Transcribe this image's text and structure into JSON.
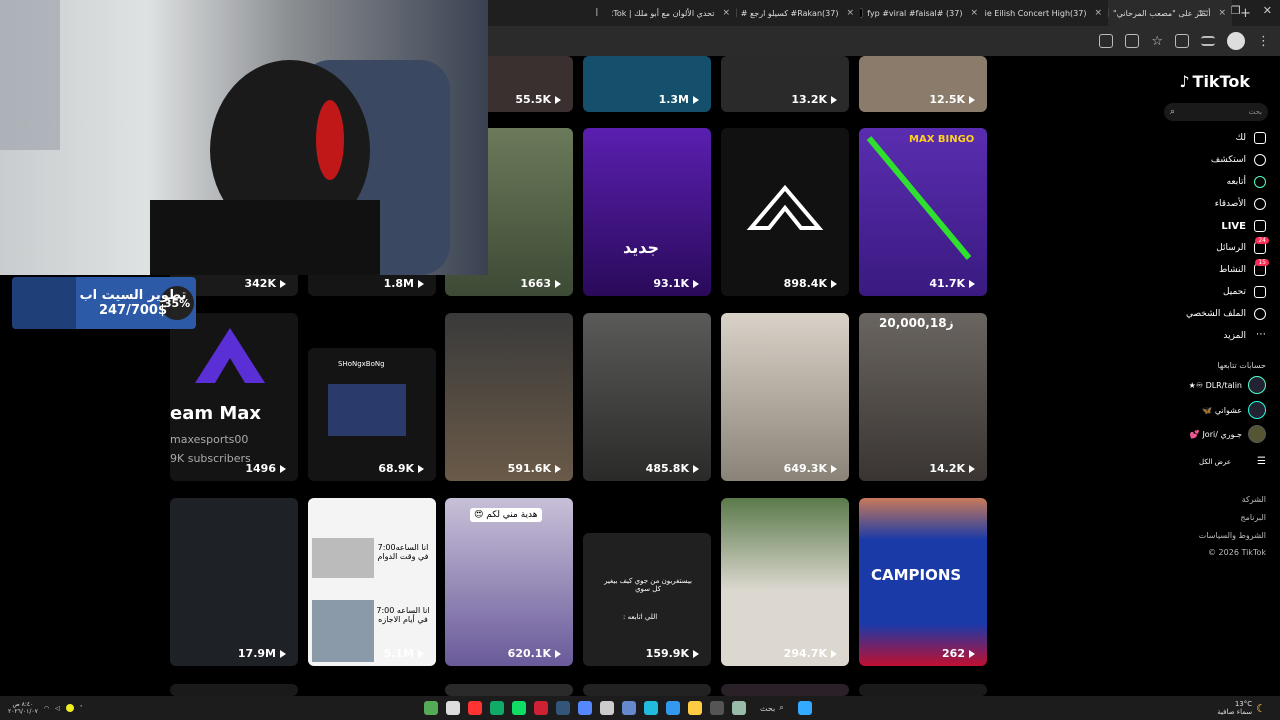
{
  "browser": {
    "tabs": [
      {
        "label": "أنظر على \"مصعب المرحاني\"",
        "close": "×"
      },
      {
        "label": "(37)Billie Eilish Concert High",
        "close": "×"
      },
      {
        "label": "(37) #fyp #viral #faisal",
        "close": "×"
      },
      {
        "label": "(37)Rakan# كسيلو ارجع #",
        "close": "×"
      },
      {
        "label": "تحدي الألوان مع أبو ملك | TikTok",
        "close": "×"
      },
      {
        "label": "أ",
        "close": ""
      }
    ],
    "new_tab": "+"
  },
  "sidebar": {
    "logo": "TikTok",
    "search_placeholder": "بحث",
    "nav": [
      {
        "label": "لك"
      },
      {
        "label": "استكشف"
      },
      {
        "label": "أتابعه"
      },
      {
        "label": "الأصدقاء"
      },
      {
        "label": "LIVE"
      },
      {
        "label": "الرسائل",
        "badge": "24"
      },
      {
        "label": "النشاط",
        "badge": "15"
      },
      {
        "label": "تحميل"
      },
      {
        "label": "الملف الشخصي"
      },
      {
        "label": "المزيد"
      }
    ],
    "following_title": "حسابات تتابعها",
    "accounts": [
      {
        "name": "DLR/talin ♾★"
      },
      {
        "name": "عشواني 🦋"
      },
      {
        "name": "جـوري /Jori 💕"
      }
    ],
    "show_all": "عرض الكل",
    "footer": [
      "الشركة",
      "البرنامج",
      "الشروط والسياسات",
      "© 2026 TikTok"
    ]
  },
  "grid": {
    "row0": [
      "55.5K",
      "1.3M",
      "13.2K",
      "12.5K"
    ],
    "row1": [
      "342K",
      "1.8M",
      "1663",
      "93.1K",
      "898.4K",
      "41.7K"
    ],
    "row2": [
      "1496",
      "68.9K",
      "591.6K",
      "485.8K",
      "649.3K",
      "14.2K"
    ],
    "row3": [
      "17.9M",
      "5.1M",
      "620.1K",
      "159.9K",
      "294.7K",
      "262"
    ],
    "overlays": {
      "team_max": "eam Max",
      "maxesports": "maxesports00",
      "subscribers": "9K subscribers",
      "shongx": "SHoNgxBoNg",
      "jadeed": "جديد",
      "max_bingo": "MAX BINGO",
      "count_2m": "20,000,18ز",
      "campions": "CAMPIONS",
      "gift": "هدية مني لكم 😍",
      "time_work": "انا الساعه7:00 في وقت الدوام",
      "time_off": "انا الساعه 7:00 في أيام الاجازه",
      "seriously": "بيستغربون من جوي كيف بيغير كل سوي",
      "followers_label": "اللي اتابعه :"
    }
  },
  "webcam": {
    "goal_title": "تطوير السيت اب",
    "goal_amount": "247/700$",
    "goal_percent": "35%",
    "goal_progress": 0.35
  },
  "taskbar": {
    "search": "بحث",
    "weather": "13°C",
    "weather_desc": "سماء صافية",
    "clock": "٨:٤٠ ص",
    "date": "٢٠٢٦/٠١/٠٧"
  },
  "colors": {
    "accent": "#fe2c55",
    "goal_bg": "#2d5aa6"
  }
}
